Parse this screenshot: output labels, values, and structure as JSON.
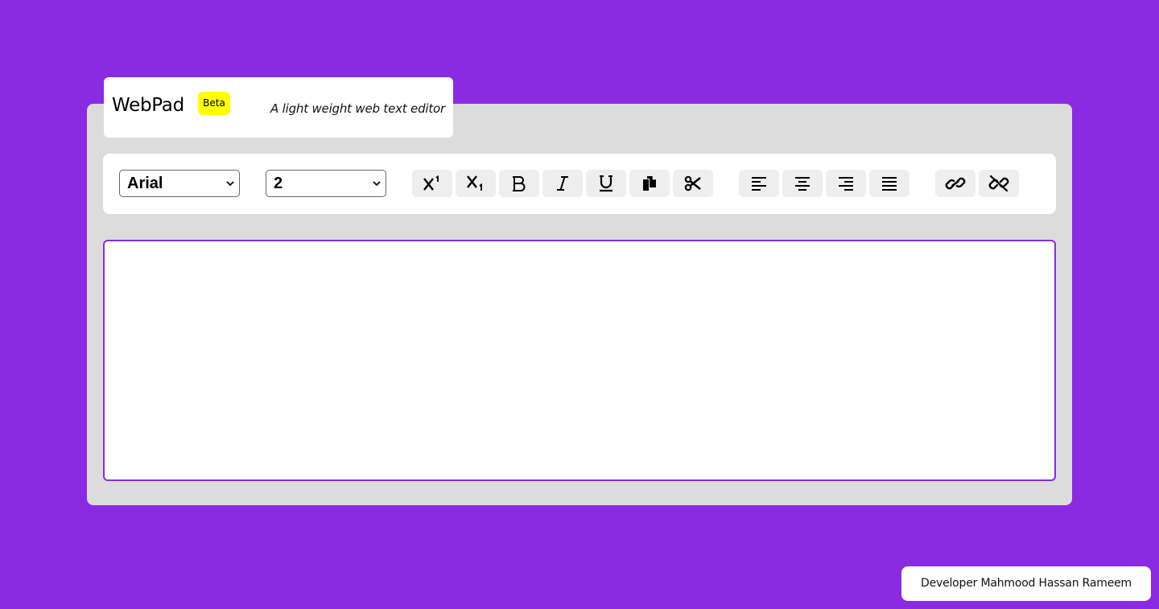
{
  "brand": {
    "name": "WebPad",
    "badge": "Beta",
    "tagline": "A light weight web text editor"
  },
  "toolbar": {
    "font_select": {
      "value": "Arial"
    },
    "size_select": {
      "value": "2"
    },
    "buttons": [
      {
        "name": "superscript",
        "icon": "superscript-icon"
      },
      {
        "name": "subscript",
        "icon": "subscript-icon"
      },
      {
        "name": "bold",
        "icon": "bold-icon"
      },
      {
        "name": "italic",
        "icon": "italic-icon"
      },
      {
        "name": "underline",
        "icon": "underline-icon"
      },
      {
        "name": "copy",
        "icon": "copy-icon"
      },
      {
        "name": "cut",
        "icon": "scissors-icon"
      },
      {
        "name": "align-left",
        "icon": "align-left-icon"
      },
      {
        "name": "align-center",
        "icon": "align-center-icon"
      },
      {
        "name": "align-right",
        "icon": "align-right-icon"
      },
      {
        "name": "justify",
        "icon": "align-justify-icon"
      },
      {
        "name": "link",
        "icon": "link-icon"
      },
      {
        "name": "unlink",
        "icon": "unlink-icon"
      }
    ]
  },
  "editor": {
    "content": ""
  },
  "footer": {
    "credit": "Developer Mahmood Hassan Rameem"
  },
  "colors": {
    "background": "#8a2be2",
    "panel": "#dcdcdc",
    "badge": "#ffff00",
    "button": "#eeeeee"
  }
}
